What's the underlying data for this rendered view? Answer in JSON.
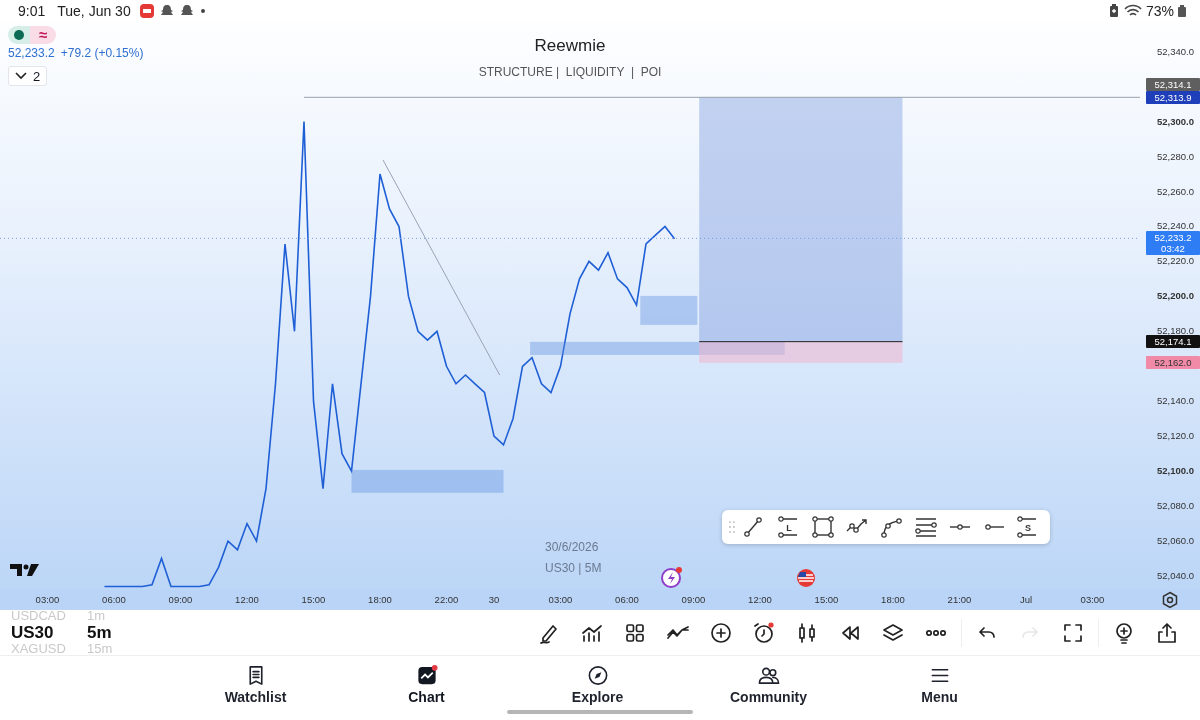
{
  "status_bar": {
    "time": "9:01",
    "date": "Tue, Jun 30",
    "battery": "73%"
  },
  "legend": {
    "status_glyph": "≈",
    "price": "52,233.2",
    "change": "+79.2 (+0.15%)",
    "collapse_count": "2"
  },
  "title": "Reewmie",
  "subtitle": "STRUCTURE |  LIQUIDITY  |  POI",
  "caption": {
    "date": "30/6/2026",
    "symbol": "US30 | 5M"
  },
  "chart": {
    "chart_data": {
      "type": "line",
      "ylim": [
        52032,
        52357
      ],
      "yticks": [
        {
          "value": 52340,
          "label": "52,340.0"
        },
        {
          "value": 52300,
          "label": "52,300.0"
        },
        {
          "value": 52280,
          "label": "52,280.0"
        },
        {
          "value": 52260,
          "label": "52,260.0"
        },
        {
          "value": 52240,
          "label": "52,240.0"
        },
        {
          "value": 52220,
          "label": "52,220.0"
        },
        {
          "value": 52200,
          "label": "52,200.0"
        },
        {
          "value": 52180,
          "label": "52,180.0"
        },
        {
          "value": 52140,
          "label": "52,140.0"
        },
        {
          "value": 52120,
          "label": "52,120.0"
        },
        {
          "value": 52100,
          "label": "52,100.0"
        },
        {
          "value": 52080,
          "label": "52,080.0"
        },
        {
          "value": 52060,
          "label": "52,060.0"
        },
        {
          "value": 52040,
          "label": "52,040.0"
        }
      ],
      "categories": [
        null,
        null,
        null,
        null,
        null,
        "03:00",
        null,
        null,
        null,
        null,
        null,
        null,
        "06:00",
        null,
        null,
        null,
        null,
        null,
        null,
        "09:00",
        null,
        null,
        null,
        null,
        null,
        null,
        "12:00",
        null,
        null,
        null,
        null,
        null,
        null,
        "15:00",
        null,
        null,
        null,
        null,
        null,
        null,
        "18:00",
        null,
        null,
        null,
        null,
        null,
        null,
        "22:00",
        null,
        null,
        null,
        null,
        "30",
        null,
        null,
        null,
        null,
        null,
        null,
        "03:00",
        null,
        null,
        null,
        null,
        null,
        null,
        "06:00",
        null,
        null,
        null,
        null,
        null,
        null,
        "09:00",
        null,
        null,
        null,
        null,
        null,
        null,
        "12:00",
        null,
        null,
        null,
        null,
        null,
        null,
        "15:00",
        null,
        null,
        null,
        null,
        null,
        null,
        "18:00",
        null,
        null,
        null,
        null,
        null,
        null,
        "21:00",
        null,
        null,
        null,
        null,
        null,
        null,
        "Jul",
        null,
        null,
        null,
        null,
        null,
        null,
        "03:00",
        null,
        null,
        null,
        null
      ],
      "series": [
        {
          "color": "#1f5fd6",
          "values": [
            null,
            null,
            null,
            null,
            null,
            null,
            null,
            null,
            null,
            null,
            null,
            52034,
            52034,
            52034,
            52034,
            52034,
            52035,
            52050,
            52034,
            52034,
            52034,
            52034,
            52035,
            52045,
            52060,
            52055,
            52070,
            52060,
            52090,
            52150,
            52230,
            52180,
            52300,
            52140,
            52090,
            52150,
            52110,
            52100,
            52150,
            52200,
            52270,
            52250,
            52240,
            52200,
            52180,
            52175,
            52180,
            52160,
            52150,
            52155,
            52150,
            52145,
            52120,
            52115,
            52130,
            52160,
            52165,
            52150,
            52145,
            52160,
            52190,
            52210,
            52220,
            52215,
            52225,
            52210,
            52205,
            52195,
            52230,
            52235,
            52240,
            52233,
            null,
            null,
            null,
            null,
            null,
            null,
            null,
            null,
            null,
            null,
            null,
            null,
            null,
            null,
            null,
            null,
            null,
            null,
            null,
            null,
            null,
            null,
            null,
            null,
            null,
            null,
            null,
            null,
            null,
            null,
            null,
            null,
            null,
            null,
            null,
            null,
            null,
            null,
            null,
            null,
            null,
            null,
            null,
            null,
            null,
            null,
            null,
            null
          ]
        }
      ]
    }
  },
  "price_labels": [
    {
      "text": "52,314.1",
      "color": "#5f5f5f"
    },
    {
      "text": "52,313.9",
      "color": "#1f3fba"
    },
    {
      "text": "52,233.2",
      "sub": "03:42",
      "color": "#2f7df5"
    },
    {
      "text": "52,174.1",
      "color": "#111111"
    },
    {
      "text": "52,162.0",
      "color": "#f08aa6"
    }
  ],
  "events": [
    {
      "kind": "flash",
      "badge": true
    },
    {
      "kind": "flag",
      "badge": false
    }
  ],
  "drawing_tools": [
    {
      "kind": "trend"
    },
    {
      "kind": "long",
      "letter": "L"
    },
    {
      "kind": "rect"
    },
    {
      "kind": "path"
    },
    {
      "kind": "curve"
    },
    {
      "kind": "parallel"
    },
    {
      "kind": "hline"
    },
    {
      "kind": "ray"
    },
    {
      "kind": "short",
      "letter": "S"
    }
  ],
  "symbol_picker": [
    {
      "symbol": "USDCAD",
      "interval": "1m",
      "selected": false
    },
    {
      "symbol": "US30",
      "interval": "5m",
      "selected": true
    },
    {
      "symbol": "XAGUSD",
      "interval": "15m",
      "selected": false
    }
  ],
  "toolbar": [
    {
      "kind": "pencil",
      "disabled": false,
      "badge": false
    },
    {
      "kind": "bars",
      "disabled": false,
      "badge": false
    },
    {
      "kind": "grid",
      "disabled": false,
      "badge": false
    },
    {
      "kind": "indicators",
      "disabled": false,
      "badge": false
    },
    {
      "kind": "plus",
      "disabled": false,
      "badge": false
    },
    {
      "kind": "alarm",
      "disabled": false,
      "badge": true
    },
    {
      "kind": "candles",
      "disabled": false,
      "badge": false
    },
    {
      "kind": "rewind",
      "disabled": false,
      "badge": false
    },
    {
      "kind": "layers",
      "disabled": false,
      "badge": false
    },
    {
      "kind": "more",
      "disabled": false,
      "badge": false
    },
    {
      "kind": "undo",
      "disabled": false,
      "badge": false
    },
    {
      "kind": "redo",
      "disabled": true,
      "badge": false
    },
    {
      "kind": "fullscreen",
      "disabled": false,
      "badge": false
    },
    {
      "kind": "bulb",
      "disabled": false,
      "badge": false
    },
    {
      "kind": "share",
      "disabled": false,
      "badge": false
    }
  ],
  "nav": [
    {
      "kind": "watchlist",
      "label": "Watchlist",
      "selected": false,
      "badge": false
    },
    {
      "kind": "chart",
      "label": "Chart",
      "selected": true,
      "badge": true
    },
    {
      "kind": "explore",
      "label": "Explore",
      "selected": false,
      "badge": false
    },
    {
      "kind": "community",
      "label": "Community",
      "selected": false,
      "badge": false
    },
    {
      "kind": "menu",
      "label": "Menu",
      "selected": false,
      "badge": false
    }
  ]
}
